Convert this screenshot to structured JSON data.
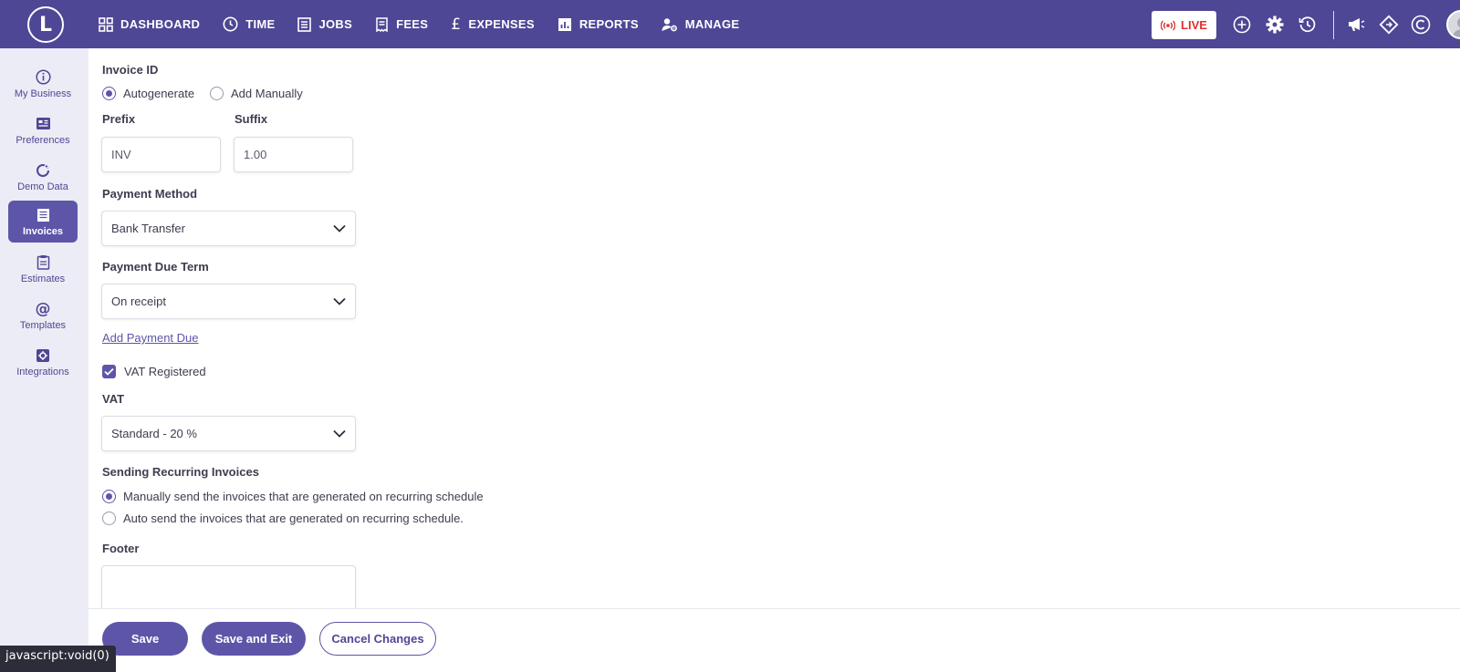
{
  "app": {
    "logo_letter": "L"
  },
  "nav": {
    "items": [
      {
        "label": "DASHBOARD",
        "icon": "grid-icon"
      },
      {
        "label": "TIME",
        "icon": "clock-icon"
      },
      {
        "label": "JOBS",
        "icon": "list-icon"
      },
      {
        "label": "FEES",
        "icon": "receipt-icon"
      },
      {
        "label": "EXPENSES",
        "icon": "pound-icon"
      },
      {
        "label": "REPORTS",
        "icon": "report-icon"
      },
      {
        "label": "MANAGE",
        "icon": "user-gear-icon"
      }
    ],
    "live_label": "LIVE",
    "right_icons": [
      "plus-circle-icon",
      "gear-icon",
      "history-icon",
      "megaphone-icon",
      "diamond-icon",
      "c-logo-icon",
      "user-avatar"
    ]
  },
  "sidebar": {
    "items": [
      {
        "label": "My Business",
        "icon": "info-icon",
        "active": false
      },
      {
        "label": "Preferences",
        "icon": "preferences-icon",
        "active": false
      },
      {
        "label": "Demo Data",
        "icon": "refresh-icon",
        "active": false
      },
      {
        "label": "Invoices",
        "icon": "invoice-icon",
        "active": true
      },
      {
        "label": "Estimates",
        "icon": "clipboard-icon",
        "active": false
      },
      {
        "label": "Templates",
        "icon": "at-icon",
        "active": false
      },
      {
        "label": "Integrations",
        "icon": "integration-icon",
        "active": false
      }
    ]
  },
  "form": {
    "invoice_id_label": "Invoice ID",
    "invoice_id_options": [
      {
        "label": "Autogenerate",
        "selected": true
      },
      {
        "label": "Add Manually",
        "selected": false
      }
    ],
    "prefix_label": "Prefix",
    "prefix_value": "INV",
    "suffix_label": "Suffix",
    "suffix_value": "1.00",
    "payment_method_label": "Payment Method",
    "payment_method_value": "Bank Transfer",
    "payment_due_term_label": "Payment Due Term",
    "payment_due_term_value": "On receipt",
    "add_payment_due_link": "Add Payment Due",
    "vat_registered_label": "VAT Registered",
    "vat_registered_checked": true,
    "vat_label": "VAT",
    "vat_value": "Standard - 20 %",
    "recurring_label": "Sending Recurring Invoices",
    "recurring_options": [
      {
        "label": "Manually send the invoices that are generated on recurring schedule",
        "selected": true
      },
      {
        "label": "Auto send the invoices that are generated on recurring schedule.",
        "selected": false
      }
    ],
    "footer_label": "Footer",
    "footer_value": ""
  },
  "actions": {
    "save": "Save",
    "save_exit": "Save and Exit",
    "cancel": "Cancel Changes"
  },
  "status_bar_text": "javascript:void(0)",
  "colors": {
    "brand": "#4e4795",
    "accent": "#5d56a8",
    "live": "#e0312c",
    "sidebar_bg": "#ececf6"
  }
}
